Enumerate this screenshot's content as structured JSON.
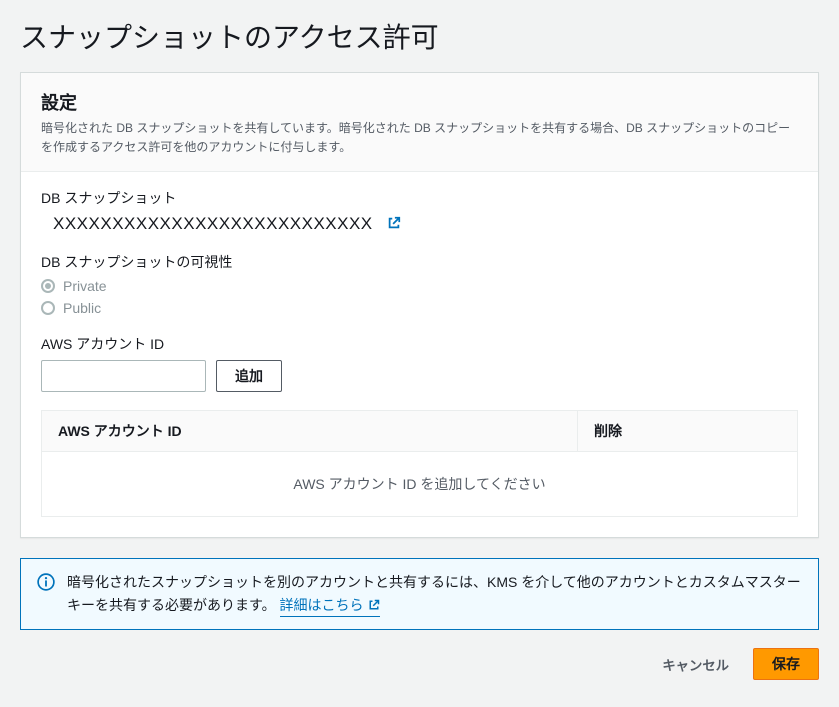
{
  "page": {
    "title": "スナップショットのアクセス許可"
  },
  "settings": {
    "heading": "設定",
    "description": "暗号化された DB スナップショットを共有しています。暗号化された DB スナップショットを共有する場合、DB スナップショットのコピーを作成するアクセス許可を他のアカウントに付与します。"
  },
  "snapshot": {
    "label": "DB スナップショット",
    "name": "XXXXXXXXXXXXXXXXXXXXXXXXXXX"
  },
  "visibility": {
    "label": "DB スナップショットの可視性",
    "options": {
      "private": "Private",
      "public": "Public"
    },
    "selected": "private"
  },
  "account": {
    "label": "AWS アカウント ID",
    "value": "",
    "add_button": "追加"
  },
  "table": {
    "col_id": "AWS アカウント ID",
    "col_delete": "削除",
    "empty_message": "AWS アカウント ID を追加してください"
  },
  "info": {
    "text": "暗号化されたスナップショットを別のアカウントと共有するには、KMS を介して他のアカウントとカスタムマスターキーを共有する必要があります。",
    "link_label": "詳細はこちら"
  },
  "footer": {
    "cancel": "キャンセル",
    "save": "保存"
  }
}
